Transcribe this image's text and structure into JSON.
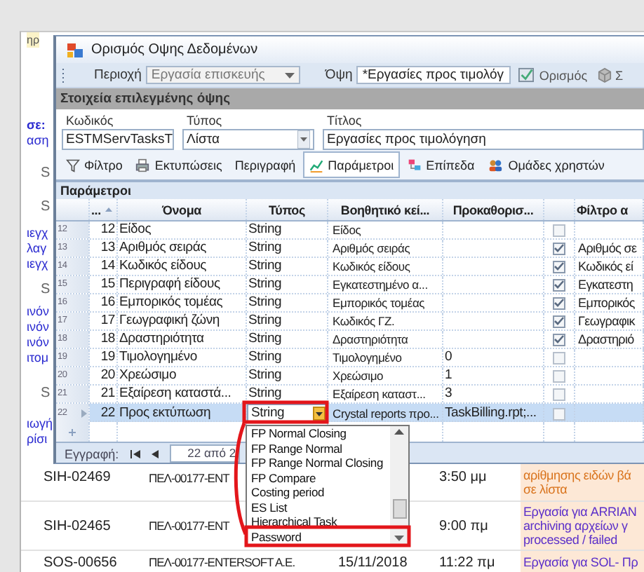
{
  "dialog": {
    "title": "Ορισμός Οψης Δεδομένων",
    "toolbar": {
      "area": {
        "label": "Περιοχή",
        "value": "Εργασία επισκευής",
        "disabled": true
      },
      "view": {
        "label": "Όψη",
        "value": "*Εργασίες προς τιμολόγ",
        "disabled": false
      },
      "define_button": "Ορισμός",
      "next_button": "Σ"
    },
    "section_title": "Στοιχεία επιλεγμένης όψης",
    "fields": [
      {
        "label": "Κωδικός",
        "value": "ESTMServTasksT",
        "kind": "text"
      },
      {
        "label": "Τύπος",
        "value": "Λίστα",
        "kind": "combo"
      },
      {
        "label": "Τίτλος",
        "value": "Εργασίες προς τιμολόγηση",
        "kind": "text"
      }
    ],
    "tabs": [
      {
        "label": "Φίλτρο",
        "selected": false
      },
      {
        "label": "Εκτυπώσεις",
        "selected": false
      },
      {
        "label": "Περιγραφή",
        "selected": false
      },
      {
        "label": "Παράμετροι",
        "selected": true
      },
      {
        "label": "Επίπεδα",
        "selected": false
      },
      {
        "label": "Ομάδες χρηστών",
        "selected": false
      }
    ],
    "grid": {
      "title": "Παράμετροι",
      "columns": [
        "...",
        "Όνομα",
        "Τύπος",
        "Βοηθητικό κεί...",
        "Προκαθορισ...",
        "Φίλτρο α"
      ],
      "rows": [
        {
          "row_number": "12",
          "id": "12",
          "name": "Είδος",
          "type": "String",
          "help": "Είδος",
          "flag": false,
          "selected": false
        },
        {
          "row_number": "13",
          "id": "13",
          "name": "Αριθμός σειράς",
          "type": "String",
          "help": "Αριθμός σειράς",
          "flag": true,
          "filter": "Αριθμός σε",
          "selected": false
        },
        {
          "row_number": "14",
          "id": "14",
          "name": "Κωδικός είδους",
          "type": "String",
          "help": "Κωδικός είδους",
          "flag": true,
          "filter": "Κωδικός εί",
          "selected": false
        },
        {
          "row_number": "15",
          "id": "15",
          "name": "Περιγραφή είδους",
          "type": "String",
          "help": "Εγκατεστημένο α...",
          "flag": true,
          "filter": "Εγκατεστη",
          "selected": false
        },
        {
          "row_number": "16",
          "id": "16",
          "name": "Εμπορικός τομέας",
          "type": "String",
          "help": "Εμπορικός τομέας",
          "flag": true,
          "filter": "Εμπορικός",
          "selected": false
        },
        {
          "row_number": "17",
          "id": "17",
          "name": "Γεωγραφική ζώνη",
          "type": "String",
          "help": "Κωδικός ΓΖ.",
          "flag": true,
          "filter": "Γεωγραφικ",
          "selected": false
        },
        {
          "row_number": "18",
          "id": "18",
          "name": "Δραστηριότητα",
          "type": "String",
          "help": "Δραστηριότητα",
          "flag": true,
          "filter": "Δραστηριό",
          "selected": false
        },
        {
          "row_number": "19",
          "id": "19",
          "name": "Τιμολογημένο",
          "type": "String",
          "help": "Τιμολογημένο",
          "default": "0",
          "flag": false,
          "selected": false
        },
        {
          "row_number": "20",
          "id": "20",
          "name": "Χρεώσιμο",
          "type": "String",
          "help": "Χρεώσιμο",
          "default": "1",
          "flag": false,
          "selected": false
        },
        {
          "row_number": "21",
          "id": "21",
          "name": "Εξαίρεση καταστά...",
          "type": "String",
          "help": "Εξαίρεση καταστ...",
          "default": "3",
          "flag": false,
          "selected": false
        },
        {
          "row_number": "22",
          "id": "22",
          "name": "Προς εκτύπωση",
          "type": "String",
          "help": "Crystal reports προ...",
          "default": "TaskBilling.rpt;...",
          "flag": false,
          "selected": true
        }
      ]
    },
    "navigator": {
      "label": "Εγγραφή:",
      "position": "22 από 2"
    }
  },
  "dropdown": {
    "items": [
      "FP Normal Closing",
      "FP Range Normal",
      "FP Range Normal Closing",
      "FP Compare",
      "Costing period",
      "ES List",
      "Hierarchical Task",
      "Password"
    ]
  },
  "background_app": {
    "side_groups": [
      {
        "kind": "caption",
        "lines": [
          "ηρ"
        ]
      },
      {
        "kind": "link",
        "lines": [
          "σε:",
          "αση"
        ]
      },
      {
        "kind": "heading",
        "lines": [
          "S"
        ]
      },
      {
        "kind": "heading",
        "lines": [
          "S"
        ]
      },
      {
        "kind": "link",
        "lines": [
          "ιεγχ",
          "λαγ",
          "ιεγχ"
        ]
      },
      {
        "kind": "heading",
        "lines": [
          "S"
        ]
      },
      {
        "kind": "link",
        "lines": [
          "ινόν",
          "ινόν",
          "ινόν",
          "ιτομ"
        ]
      },
      {
        "kind": "heading",
        "lines": [
          "S"
        ]
      },
      {
        "kind": "link",
        "lines": [
          "ιωγή",
          "ρίσι"
        ]
      }
    ],
    "records": [
      {
        "code": "SIH-02469",
        "customer": "ΠΕΛ-00177-ENT",
        "time": "3:50 μμ",
        "description": [
          "αρίθμησης ειδών βά",
          "σε λίστα"
        ],
        "color": "#d9731c"
      },
      {
        "code": "SIH-02465",
        "customer": "ΠΕΛ-00177-ENT",
        "time": "9:00 πμ",
        "description": [
          "Εργασία για ARRIAN",
          "archiving αρχείων γ",
          "processed / failed"
        ],
        "color": "#5b2fc9"
      },
      {
        "code": "SOS-00656",
        "customer": "ΠΕΛ-00177-ENTERSOFT A.E.",
        "date": "15/11/2018",
        "time": "11:22 πμ",
        "description": [
          "Εργασία για SOL- Πρ"
        ],
        "color": "#5b2fc9"
      }
    ]
  }
}
